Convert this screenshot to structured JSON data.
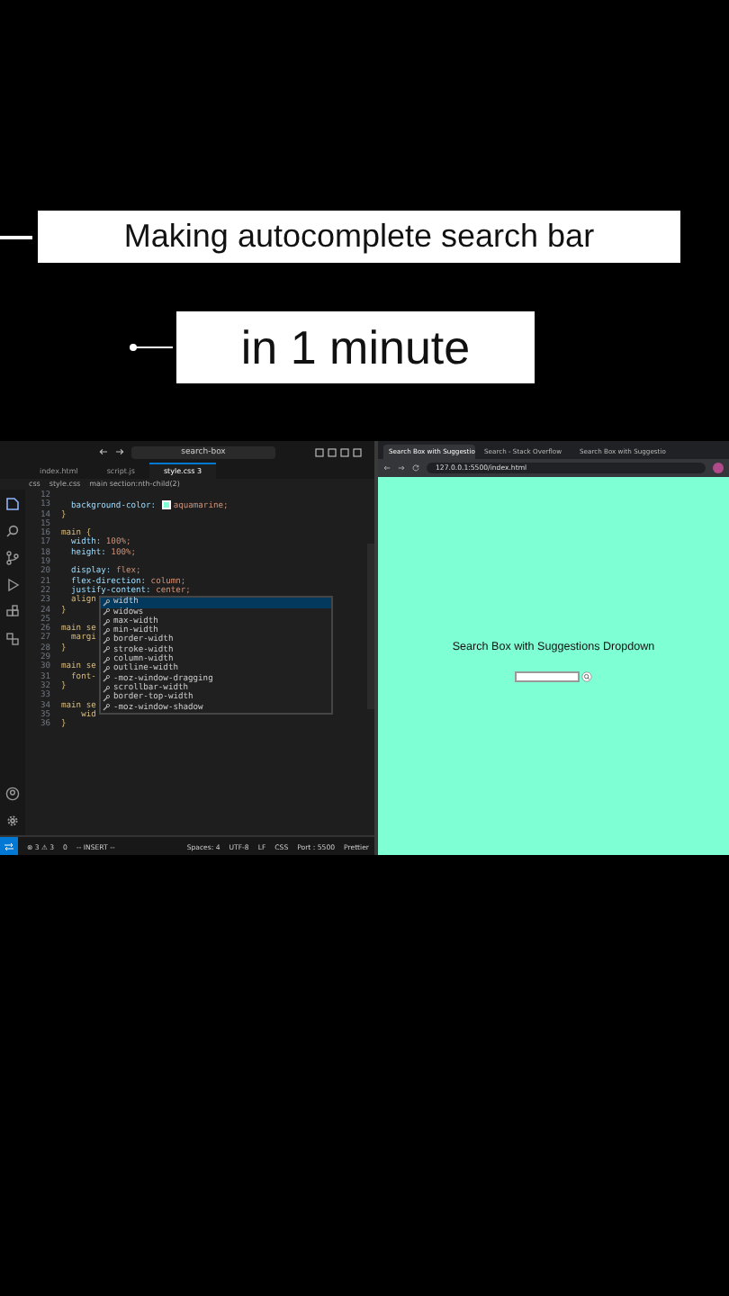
{
  "captions": [
    {
      "text": "Making autocomplete search bar",
      "kind": "line"
    },
    {
      "text": "in 1 minute",
      "kind": "dot"
    }
  ],
  "editor": {
    "command_center": "search-box",
    "tabs": [
      {
        "label": "index.html",
        "selected": false
      },
      {
        "label": "script.js",
        "selected": false
      },
      {
        "label": "style.css 3",
        "selected": true
      }
    ],
    "breadcrumb": [
      "css",
      "style.css",
      "main section:nth-child(2)"
    ],
    "lines": [
      {
        "number": "12",
        "kind": "code"
      },
      {
        "number": "13",
        "kind": "swatch",
        "code": "  background-color: ",
        "value": "aquamarine;"
      },
      {
        "number": "14",
        "kind": "code",
        "code": "}"
      },
      {
        "number": "15",
        "kind": "code"
      },
      {
        "number": "16",
        "kind": "code",
        "code": "main {"
      },
      {
        "number": "17",
        "kind": "code",
        "code": "  width: 100%;"
      },
      {
        "number": "18",
        "kind": "code",
        "code": "  height: 100%;"
      },
      {
        "number": "19",
        "kind": "code"
      },
      {
        "number": "20",
        "kind": "code",
        "code": "  display: flex;"
      },
      {
        "number": "21",
        "kind": "code",
        "code": "  flex-direction: column;"
      },
      {
        "number": "22",
        "kind": "code",
        "code": "  justify-content: center;"
      },
      {
        "number": "23",
        "kind": "code",
        "code": "  align"
      },
      {
        "number": "24",
        "kind": "code",
        "code": "}"
      },
      {
        "number": "25",
        "kind": "code"
      },
      {
        "number": "26",
        "kind": "code",
        "code": "main se"
      },
      {
        "number": "27",
        "kind": "code",
        "code": "  margi"
      },
      {
        "number": "28",
        "kind": "code",
        "code": "}"
      },
      {
        "number": "29",
        "kind": "code"
      },
      {
        "number": "30",
        "kind": "code",
        "code": "main se"
      },
      {
        "number": "31",
        "kind": "code",
        "code": "  font-"
      },
      {
        "number": "32",
        "kind": "code",
        "code": "}"
      },
      {
        "number": "33",
        "kind": "code"
      },
      {
        "number": "34",
        "kind": "code",
        "code": "main se"
      },
      {
        "number": "35",
        "kind": "code",
        "code": "    wid"
      },
      {
        "number": "36",
        "kind": "code",
        "code": "}"
      }
    ],
    "suggestions": [
      {
        "label": "width",
        "selected": true
      },
      {
        "label": "widows",
        "selected": false
      },
      {
        "label": "max-width",
        "selected": false
      },
      {
        "label": "min-width",
        "selected": false
      },
      {
        "label": "border-width",
        "selected": false
      },
      {
        "label": "stroke-width",
        "selected": false
      },
      {
        "label": "column-width",
        "selected": false
      },
      {
        "label": "outline-width",
        "selected": false
      },
      {
        "label": "-moz-window-dragging",
        "selected": false
      },
      {
        "label": "scrollbar-width",
        "selected": false
      },
      {
        "label": "border-top-width",
        "selected": false
      },
      {
        "label": "-moz-window-shadow",
        "selected": false
      }
    ],
    "status_bar": {
      "problems": "⊗ 3 ⚠ 3",
      "ports": "0",
      "mode": "-- INSERT --",
      "right": [
        "Spaces: 4",
        "UTF-8",
        "LF",
        "CSS",
        "Port : 5500",
        "Prettier"
      ]
    }
  },
  "browser": {
    "tabs": [
      {
        "label": "Search Box with Suggestio",
        "selected": true
      },
      {
        "label": "Search - Stack Overflow",
        "selected": false
      },
      {
        "label": "Search Box with Suggestio",
        "selected": false
      }
    ],
    "url": "127.0.0.1:5500/index.html",
    "heading": "Search Box with Suggestions Dropdown"
  }
}
